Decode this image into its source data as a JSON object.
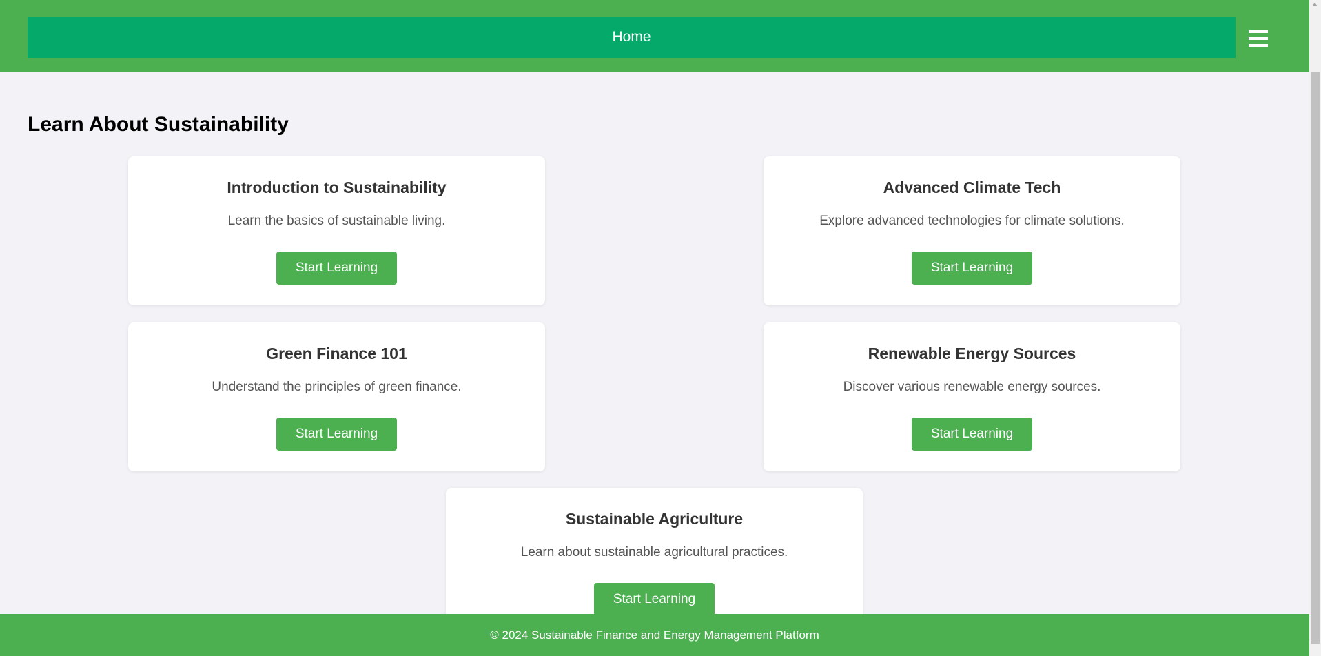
{
  "nav": {
    "home_label": "Home",
    "menu_icon": "hamburger-menu-icon"
  },
  "main": {
    "title": "Learn About Sustainability",
    "courses": [
      {
        "title": "Introduction to Sustainability",
        "description": "Learn the basics of sustainable living.",
        "button_label": "Start Learning"
      },
      {
        "title": "Advanced Climate Tech",
        "description": "Explore advanced technologies for climate solutions.",
        "button_label": "Start Learning"
      },
      {
        "title": "Green Finance 101",
        "description": "Understand the principles of green finance.",
        "button_label": "Start Learning"
      },
      {
        "title": "Renewable Energy Sources",
        "description": "Discover various renewable energy sources.",
        "button_label": "Start Learning"
      },
      {
        "title": "Sustainable Agriculture",
        "description": "Learn about sustainable agricultural practices.",
        "button_label": "Start Learning"
      }
    ]
  },
  "footer": {
    "text": "© 2024 Sustainable Finance and Energy Management Platform"
  },
  "colors": {
    "header_bg": "#4caf50",
    "nav_bg": "#05a96a",
    "button_bg": "#4caf50",
    "page_bg": "#f3f3f7"
  }
}
